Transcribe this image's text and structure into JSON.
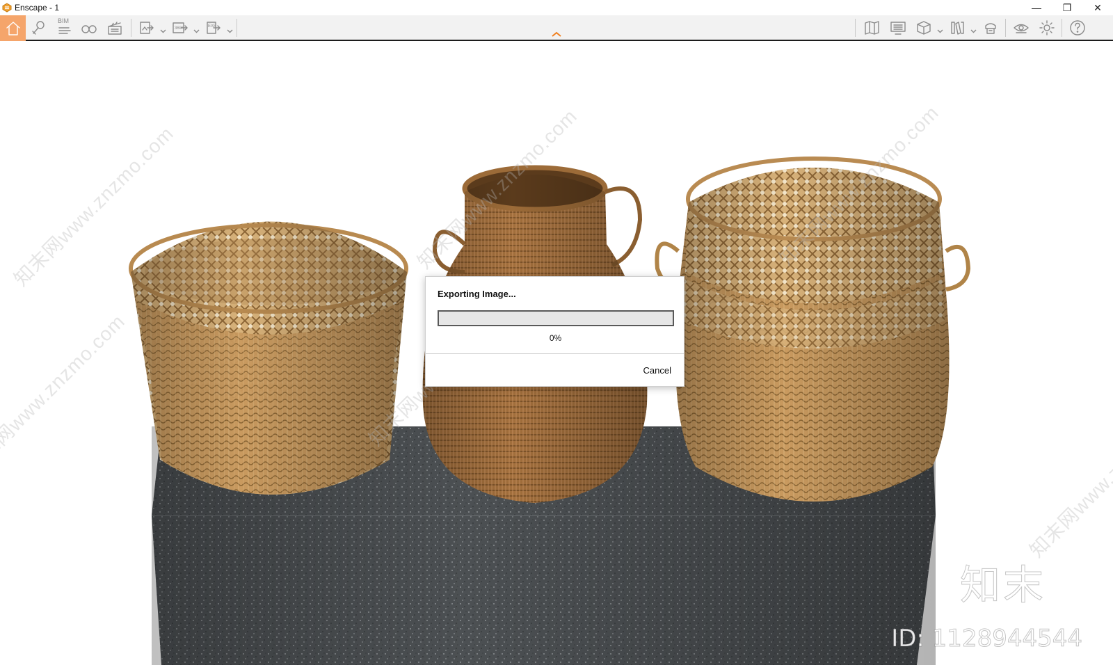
{
  "window": {
    "title": "Enscape - 1",
    "controls": {
      "minimize": "—",
      "restore": "❐",
      "close": "✕"
    }
  },
  "toolbar": {
    "bim_label": "BIM",
    "accent_color": "#f5a56b",
    "left_tools": [
      "home-icon",
      "location-icon",
      "bim-icon",
      "binoculars-icon",
      "clapperboard-icon"
    ],
    "export_tools": [
      "screenshot-export-icon",
      "panorama-export-icon",
      "exe-export-icon"
    ],
    "right_tools": [
      "map-icon",
      "monitor-icon",
      "cube-icon",
      "books-icon",
      "asset-library-icon",
      "eye-icon",
      "gear-icon",
      "help-icon"
    ]
  },
  "dialog": {
    "title": "Exporting Image...",
    "progress": 0,
    "progress_text": "0%",
    "cancel_label": "Cancel"
  },
  "watermark": {
    "site": "知末网www.znzmo.com",
    "brand": "知末",
    "id_text": "ID: 1128944544"
  }
}
